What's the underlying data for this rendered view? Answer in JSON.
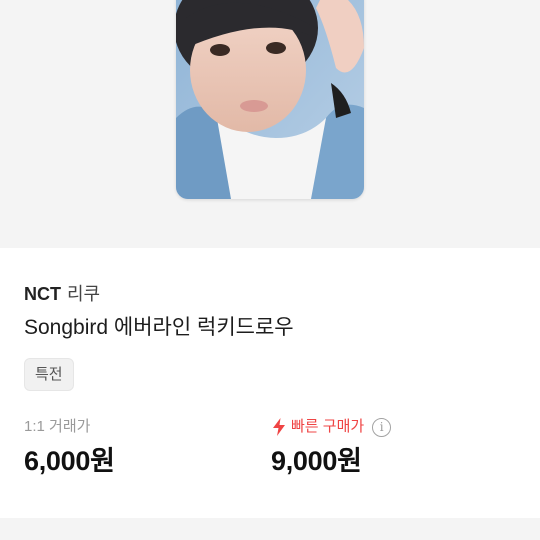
{
  "product": {
    "artist": "NCT",
    "member": "리쿠",
    "title": "Songbird 에버라인 럭키드로우",
    "tag": "특전"
  },
  "prices": {
    "trade_label": "1:1 거래가",
    "trade_value": "6,000원",
    "fast_label": "빠른 구매가",
    "fast_value": "9,000원",
    "info_glyph": "i"
  },
  "icons": {
    "fast": "lightning-bolt-icon",
    "info": "info-circle-icon"
  },
  "colors": {
    "accent_red": "#ef4444",
    "muted_gray": "#9a9a9a",
    "hero_bg": "#f4f4f4"
  }
}
